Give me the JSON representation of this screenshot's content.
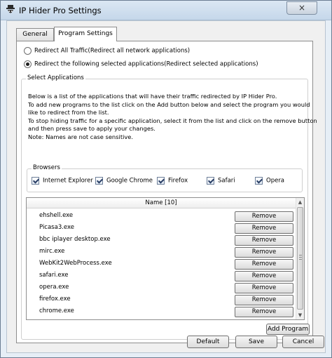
{
  "window": {
    "title": "IP Hider Pro Settings"
  },
  "tabs": [
    {
      "label": "General"
    },
    {
      "label": "Program Settings"
    }
  ],
  "redirect": {
    "all_label": "Redirect All Traffic(Redirect all network applications)",
    "selected_label": "Redirect the following selected applications(Redirect selected applications)",
    "selected_option": "selected"
  },
  "select_apps": {
    "title": "Select Applications",
    "desc": [
      "Below is a list of the applications that will have their traffic redirected by IP Hider Pro.",
      "To add new programs to the list click on the Add button below and select the program you would",
      "like to redirect from the list.",
      "To stop hiding traffic for a specific application, select it from the list and click on the remove button",
      "and then press save to apply your changes.",
      "Note: Names are not case sensitive."
    ]
  },
  "browsers": {
    "title": "Browsers",
    "items": [
      {
        "label": "Internet Explorer",
        "checked": true
      },
      {
        "label": "Google Chrome",
        "checked": true
      },
      {
        "label": "Firefox",
        "checked": true
      },
      {
        "label": "Safari",
        "checked": true
      },
      {
        "label": "Opera",
        "checked": true
      }
    ]
  },
  "app_list": {
    "header": "Name [10]",
    "remove_label": "Remove",
    "rows": [
      "ehshell.exe",
      "Picasa3.exe",
      "bbc iplayer desktop.exe",
      "mirc.exe",
      "WebKit2WebProcess.exe",
      "safari.exe",
      "opera.exe",
      "firefox.exe",
      "chrome.exe"
    ]
  },
  "buttons": {
    "add_program": "Add Program",
    "default": "Default",
    "save": "Save",
    "cancel": "Cancel"
  },
  "icons": {
    "close": "×"
  }
}
